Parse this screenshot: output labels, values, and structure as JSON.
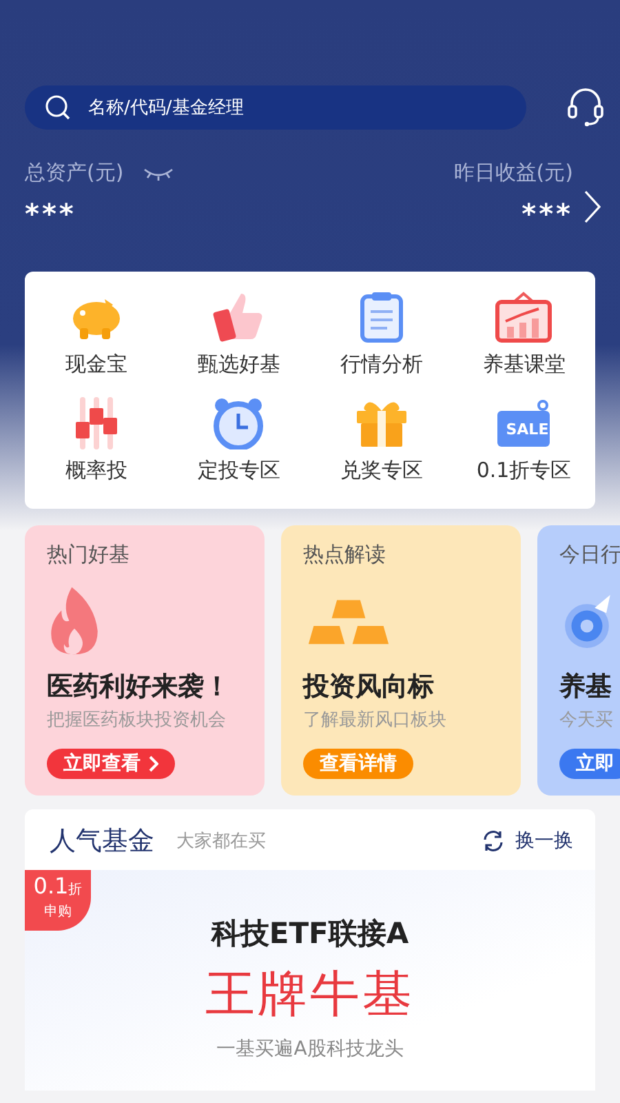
{
  "search": {
    "placeholder": "名称/代码/基金经理"
  },
  "assets": {
    "total_label": "总资产(元)",
    "total_value": "***",
    "yesterday_label": "昨日收益(元)",
    "yesterday_value": "***",
    "hidden": true
  },
  "menu": [
    {
      "label": "现金宝",
      "kind": "piggy"
    },
    {
      "label": "甄选好基",
      "kind": "thumb"
    },
    {
      "label": "行情分析",
      "kind": "clipboard"
    },
    {
      "label": "养基课堂",
      "kind": "board"
    },
    {
      "label": "概率投",
      "kind": "candles"
    },
    {
      "label": "定投专区",
      "kind": "clock"
    },
    {
      "label": "兑奖专区",
      "kind": "gift"
    },
    {
      "label": "0.1折专区",
      "kind": "sale",
      "tag": "SALE"
    }
  ],
  "promos": [
    {
      "kind": "red",
      "title": "热门好基",
      "headline": "医药利好来袭！",
      "subtitle": "把握医药板块投资机会",
      "button": "立即查看",
      "arrow": true
    },
    {
      "kind": "orange",
      "title": "热点解读",
      "headline": "投资风向标",
      "subtitle": "了解最新风口板块",
      "button": "查看详情",
      "arrow": false
    },
    {
      "kind": "blue",
      "title": "今日行",
      "headline": "养基",
      "subtitle": "今天买",
      "button": "立即",
      "arrow": false
    }
  ],
  "popular": {
    "title": "人气基金",
    "subtitle": "大家都在买",
    "refresh": "换一换",
    "badge_value": "0.1",
    "badge_unit": "折",
    "badge_note": "申购",
    "fund_name": "科技ETF联接A",
    "slogan": "王牌牛基",
    "description": "一基买遍A股科技龙头"
  }
}
